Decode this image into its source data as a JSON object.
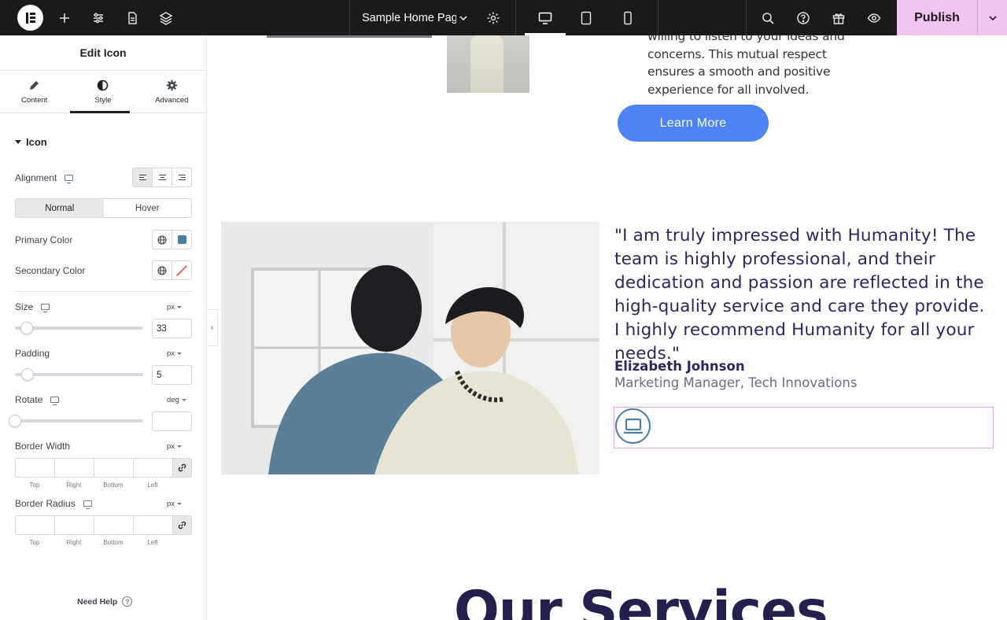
{
  "topbar": {
    "page_name": "Sample Home Page",
    "publish_label": "Publish",
    "icons": [
      "elementor-logo",
      "add-icon",
      "sliders-icon",
      "page-icon",
      "layers-icon",
      "chevron-down-icon",
      "gear-icon",
      "desktop-icon",
      "tablet-icon",
      "mobile-icon",
      "search-icon",
      "help-icon",
      "gift-icon",
      "eye-icon"
    ]
  },
  "panel": {
    "title": "Edit Icon",
    "tabs": [
      {
        "label": "Content",
        "icon": "pencil-icon"
      },
      {
        "label": "Style",
        "icon": "contrast-icon",
        "active": true
      },
      {
        "label": "Advanced",
        "icon": "gear-icon"
      }
    ],
    "section": "Icon",
    "alignment_label": "Alignment",
    "state_tabs": [
      "Normal",
      "Hover"
    ],
    "primary_color_label": "Primary Color",
    "primary_color": "#4a7f9e",
    "secondary_color_label": "Secondary Color",
    "size_label": "Size",
    "size_unit": "px",
    "size_value": "33",
    "padding_label": "Padding",
    "padding_unit": "px",
    "padding_value": "5",
    "rotate_label": "Rotate",
    "rotate_unit": "deg",
    "rotate_value": "",
    "border_width_label": "Border Width",
    "border_width_unit": "px",
    "border_radius_label": "Border Radius",
    "border_radius_unit": "px",
    "dim_labels": [
      "Top",
      "Right",
      "Bottom",
      "Left"
    ],
    "need_help": "Need Help",
    "help_glyph": "?",
    "collapse_glyph": "‹"
  },
  "canvas": {
    "top_text": "willing to listen to your ideas and concerns. This mutual respect ensures a smooth and positive experience for all involved.",
    "learn_more": "Learn More",
    "quote": "\"I am truly impressed with Humanity! The team is highly professional, and their dedication and passion are reflected in the high-quality service and care they provide. I highly recommend Humanity for all your needs.\"",
    "author": "Elizabeth Johnson",
    "role": "Marketing Manager, Tech Innovations",
    "services_heading": "Our Services",
    "accent": "#4e83f5",
    "heading_color": "#2b2660"
  }
}
